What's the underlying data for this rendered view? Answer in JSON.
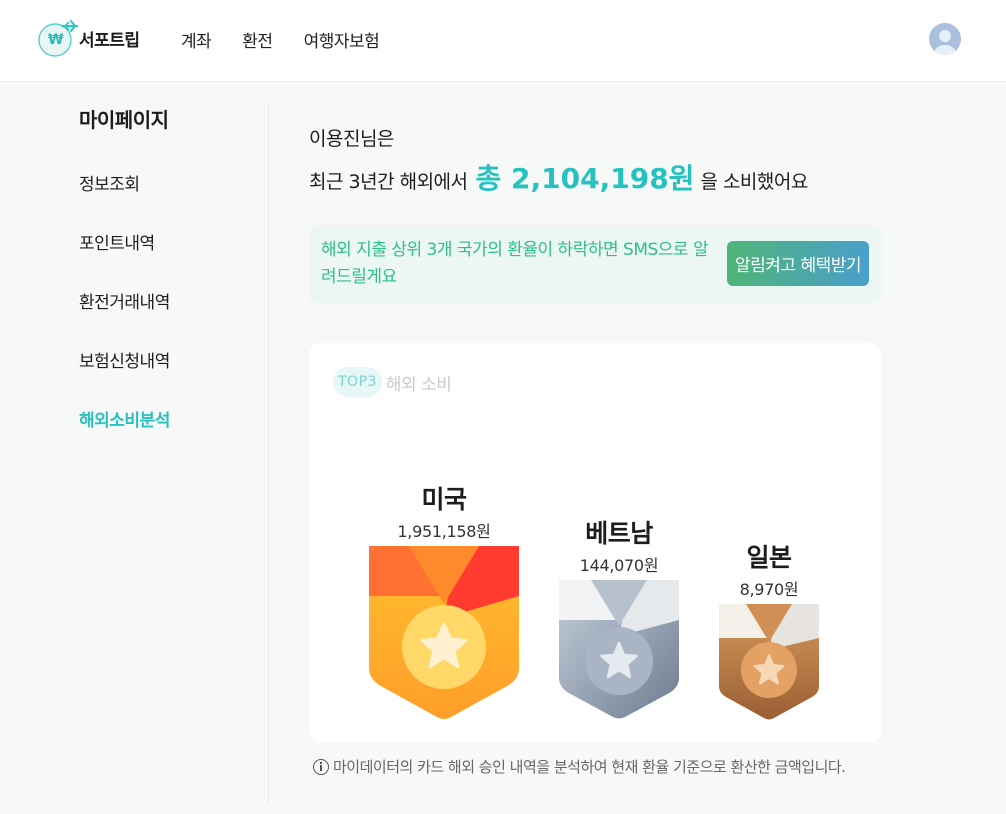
{
  "header": {
    "brand": "서포트립",
    "logo_symbol": "₩",
    "nav": [
      "계좌",
      "환전",
      "여행자보험"
    ]
  },
  "sidebar": {
    "title": "마이페이지",
    "items": [
      {
        "label": "정보조회",
        "active": false
      },
      {
        "label": "포인트내역",
        "active": false
      },
      {
        "label": "환전거래내역",
        "active": false
      },
      {
        "label": "보험신청내역",
        "active": false
      },
      {
        "label": "해외소비분석",
        "active": true
      }
    ]
  },
  "summary": {
    "name_line": "이용진님은",
    "prefix": "최근 3년간 해외에서",
    "total": "총 2,104,198원",
    "suffix": "을 소비했어요"
  },
  "alert": {
    "text": "해외 지출 상위 3개 국가의 환율이 하락하면 SMS으로 알려드릴게요",
    "button": "알림켜고 혜택받기"
  },
  "ranking": {
    "badge": "TOP3",
    "title": "해외 소비",
    "items": [
      {
        "rank": 1,
        "country": "미국",
        "amount": "1,951,158원",
        "medal": "gold"
      },
      {
        "rank": 2,
        "country": "베트남",
        "amount": "144,070원",
        "medal": "silver"
      },
      {
        "rank": 3,
        "country": "일본",
        "amount": "8,970원",
        "medal": "bronze"
      }
    ]
  },
  "footnote": "마이데이터의 카드 해외 승인 내역을 분석하여 현재 환율 기준으로 환산한 금액입니다.",
  "colors": {
    "accent": "#27c1bf",
    "alert_text": "#2dbf8c",
    "alert_bg": "#ecf6f2",
    "gold": "#ffb42e",
    "silver": "#9aa6b6",
    "bronze": "#b87a45"
  }
}
